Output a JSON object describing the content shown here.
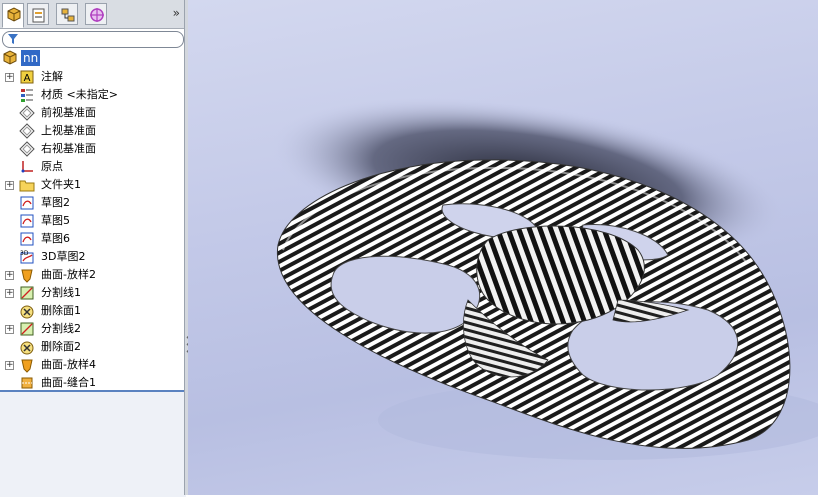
{
  "tabs": [
    {
      "name": "feature-manager",
      "icon": "feature-tree-icon"
    },
    {
      "name": "property-manager",
      "icon": "property-manager-icon"
    },
    {
      "name": "configuration-manager",
      "icon": "configuration-icon"
    },
    {
      "name": "dim-xpert-manager",
      "icon": "dimxpert-icon"
    }
  ],
  "tab_more": "»",
  "filter_icon": "filter-icon",
  "root": {
    "label": "nn",
    "icon": "part-icon"
  },
  "tree": [
    {
      "label": "注解",
      "icon": "annotation-icon",
      "expand": "+"
    },
    {
      "label": "材质 <未指定>",
      "icon": "material-icon",
      "expand": ""
    },
    {
      "label": "前视基准面",
      "icon": "plane-icon",
      "expand": ""
    },
    {
      "label": "上视基准面",
      "icon": "plane-icon",
      "expand": ""
    },
    {
      "label": "右视基准面",
      "icon": "plane-icon",
      "expand": ""
    },
    {
      "label": "原点",
      "icon": "origin-icon",
      "expand": ""
    },
    {
      "label": "文件夹1",
      "icon": "folder-icon",
      "expand": "+"
    },
    {
      "label": "草图2",
      "icon": "sketch-icon",
      "expand": ""
    },
    {
      "label": "草图5",
      "icon": "sketch-icon",
      "expand": ""
    },
    {
      "label": "草图6",
      "icon": "sketch-icon",
      "expand": ""
    },
    {
      "label": "3D草图2",
      "icon": "3d-sketch-icon",
      "expand": ""
    },
    {
      "label": "曲面-放样2",
      "icon": "surface-loft-icon",
      "expand": "+"
    },
    {
      "label": "分割线1",
      "icon": "split-line-icon",
      "expand": "+"
    },
    {
      "label": "删除面1",
      "icon": "delete-face-icon",
      "expand": ""
    },
    {
      "label": "分割线2",
      "icon": "split-line-icon",
      "expand": "+"
    },
    {
      "label": "删除面2",
      "icon": "delete-face-icon",
      "expand": ""
    },
    {
      "label": "曲面-放样4",
      "icon": "surface-loft-icon",
      "expand": "+"
    },
    {
      "label": "曲面-缝合1",
      "icon": "surface-knit-icon",
      "expand": ""
    }
  ],
  "colors": {
    "accent": "#3169c6",
    "viewport_bg": "#c3c9e8",
    "panel_bg": "#ffffff"
  }
}
